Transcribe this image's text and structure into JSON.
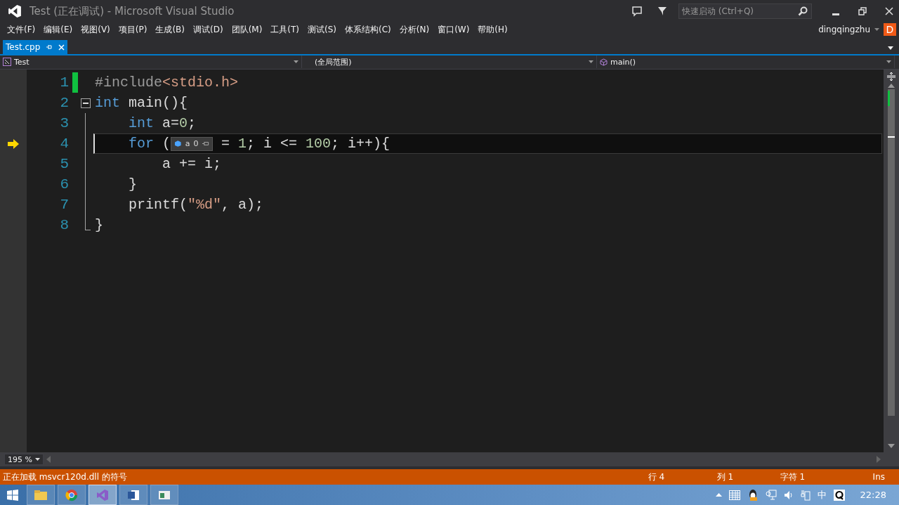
{
  "window": {
    "title": "Test (正在调试) - Microsoft Visual Studio"
  },
  "quick_launch": {
    "placeholder": "快速启动 (Ctrl+Q)"
  },
  "menu": [
    "文件(F)",
    "编辑(E)",
    "视图(V)",
    "项目(P)",
    "生成(B)",
    "调试(D)",
    "团队(M)",
    "工具(T)",
    "测试(S)",
    "体系结构(C)",
    "分析(N)",
    "窗口(W)",
    "帮助(H)"
  ],
  "account": {
    "name": "dingqingzhu",
    "initial": "D"
  },
  "tabs": [
    {
      "label": "Test.cpp",
      "selected": true
    }
  ],
  "navigation": {
    "project": "Test",
    "scope": "(全局范围)",
    "member": "main()"
  },
  "code_lines": [
    {
      "number": "1",
      "current": false,
      "changed": true,
      "tokens": [
        {
          "kind": "pre",
          "text": "#include"
        },
        {
          "kind": "str",
          "text": "<stdio.h>"
        }
      ]
    },
    {
      "number": "2",
      "current": false,
      "changed": false,
      "tokens": [
        {
          "kind": "kw",
          "text": "int"
        },
        {
          "kind": "plain",
          "text": " main(){"
        }
      ]
    },
    {
      "number": "3",
      "current": false,
      "changed": false,
      "tokens": [
        {
          "kind": "kw",
          "text": "    int"
        },
        {
          "kind": "plain",
          "text": " a="
        },
        {
          "kind": "num",
          "text": "0"
        },
        {
          "kind": "plain",
          "text": ";"
        }
      ]
    },
    {
      "number": "4",
      "current": true,
      "changed": false,
      "tokens": [
        {
          "kind": "kw",
          "text": "    for"
        },
        {
          "kind": "plain",
          "text": " ("
        },
        {
          "kind": "datatip",
          "name": "a",
          "value": "0"
        },
        {
          "kind": "plain",
          "text": " = "
        },
        {
          "kind": "num",
          "text": "1"
        },
        {
          "kind": "plain",
          "text": "; i <= "
        },
        {
          "kind": "num",
          "text": "100"
        },
        {
          "kind": "plain",
          "text": "; i++){"
        }
      ]
    },
    {
      "number": "5",
      "current": false,
      "changed": false,
      "tokens": [
        {
          "kind": "plain",
          "text": "        a += i;"
        }
      ]
    },
    {
      "number": "6",
      "current": false,
      "changed": false,
      "tokens": [
        {
          "kind": "plain",
          "text": "    }"
        }
      ]
    },
    {
      "number": "7",
      "current": false,
      "changed": false,
      "tokens": [
        {
          "kind": "plain",
          "text": "    printf("
        },
        {
          "kind": "str",
          "text": "\"%d\""
        },
        {
          "kind": "plain",
          "text": ", a);"
        }
      ]
    },
    {
      "number": "8",
      "current": false,
      "changed": false,
      "tokens": [
        {
          "kind": "plain",
          "text": "}"
        }
      ]
    }
  ],
  "zoom": "195 %",
  "status_bar": {
    "message": "正在加载 msvcr120d.dll 的符号",
    "line": "行 4",
    "column": "列 1",
    "char": "字符 1",
    "mode": "Ins"
  },
  "taskbar": {
    "apps": [
      {
        "kind": "explorer",
        "selected": false
      },
      {
        "kind": "chrome",
        "selected": false
      },
      {
        "kind": "vs",
        "selected": true
      },
      {
        "kind": "word",
        "selected": false
      },
      {
        "kind": "window",
        "selected": false
      }
    ],
    "ime": "中",
    "time": "22:28"
  }
}
